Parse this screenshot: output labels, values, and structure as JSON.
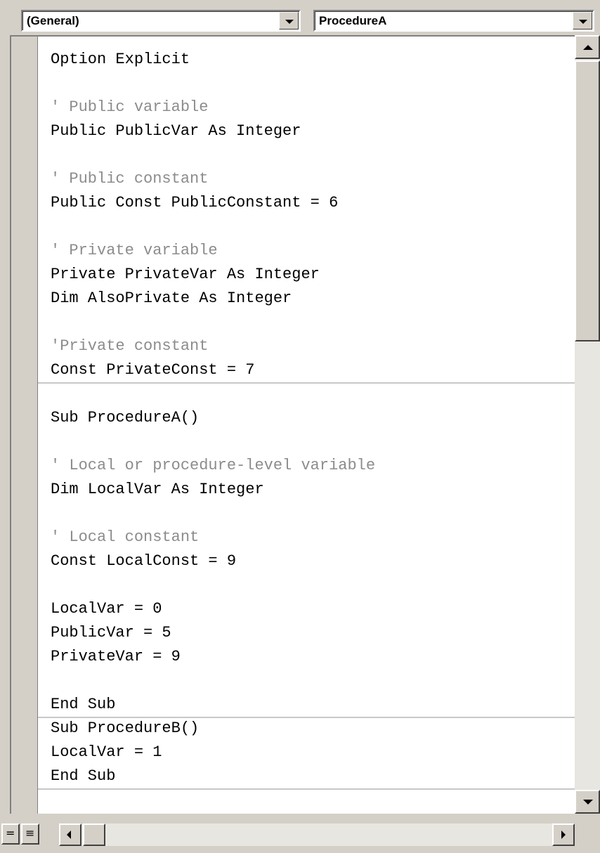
{
  "object_combo": {
    "value": "(General)"
  },
  "procedure_combo": {
    "value": "ProcedureA"
  },
  "code": {
    "declarations": [
      {
        "text": "Option Explicit",
        "kind": "code"
      },
      {
        "text": "",
        "kind": "code"
      },
      {
        "text": "' Public variable",
        "kind": "comment"
      },
      {
        "text": "Public PublicVar As Integer",
        "kind": "code"
      },
      {
        "text": "",
        "kind": "code"
      },
      {
        "text": "' Public constant",
        "kind": "comment"
      },
      {
        "text": "Public Const PublicConstant = 6",
        "kind": "code"
      },
      {
        "text": "",
        "kind": "code"
      },
      {
        "text": "' Private variable",
        "kind": "comment"
      },
      {
        "text": "Private PrivateVar As Integer",
        "kind": "code"
      },
      {
        "text": "Dim AlsoPrivate As Integer",
        "kind": "code"
      },
      {
        "text": "",
        "kind": "code"
      },
      {
        "text": "'Private constant",
        "kind": "comment"
      },
      {
        "text": "Const PrivateConst = 7",
        "kind": "code"
      }
    ],
    "procedure_a": [
      {
        "text": "",
        "kind": "code"
      },
      {
        "text": "Sub ProcedureA()",
        "kind": "code"
      },
      {
        "text": "",
        "kind": "code"
      },
      {
        "text": "' Local or procedure-level variable",
        "kind": "comment"
      },
      {
        "text": "Dim LocalVar As Integer",
        "kind": "code"
      },
      {
        "text": "",
        "kind": "code"
      },
      {
        "text": "' Local constant",
        "kind": "comment"
      },
      {
        "text": "Const LocalConst = 9",
        "kind": "code"
      },
      {
        "text": "",
        "kind": "code"
      },
      {
        "text": "LocalVar = 0",
        "kind": "code"
      },
      {
        "text": "PublicVar = 5",
        "kind": "code"
      },
      {
        "text": "PrivateVar = 9",
        "kind": "code"
      },
      {
        "text": "",
        "kind": "code"
      },
      {
        "text": "End Sub",
        "kind": "code"
      }
    ],
    "procedure_b": [
      {
        "text": "Sub ProcedureB()",
        "kind": "code"
      },
      {
        "text": "LocalVar = 1",
        "kind": "code"
      },
      {
        "text": "End Sub",
        "kind": "code"
      }
    ]
  },
  "colors": {
    "comment": "#8c8c8c",
    "code": "#000000",
    "chrome": "#d4d0c8"
  }
}
